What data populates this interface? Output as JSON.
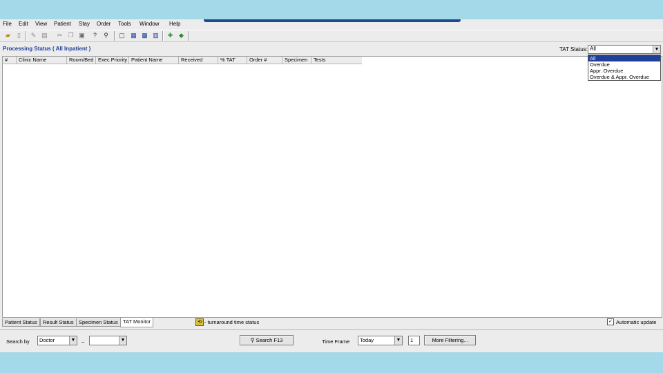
{
  "menu": [
    "File",
    "Edit",
    "View",
    "Patient",
    "Stay",
    "Order",
    "Tools",
    "Window",
    "Help"
  ],
  "toolbar_icons": [
    "folder-open",
    "document",
    "edit",
    "print",
    "cut",
    "copy",
    "paste",
    "help",
    "find",
    "doc-new",
    "window",
    "grid",
    "chart",
    "lab",
    "pill"
  ],
  "header": {
    "title": "Processing Status ( All Inpatient )",
    "tat_status_label": "TAT Status:",
    "tat_status_value": "All",
    "tat_options": [
      "All",
      "Overdue",
      "Appr. Overdue",
      "Overdue & Appr. Overdue"
    ]
  },
  "columns": [
    "#",
    "Clinic Name",
    "Room/Bed",
    "Exec.Priority",
    "Patient Name",
    "Received",
    "% TAT",
    "Order #",
    "Specimen",
    "Tests"
  ],
  "tabs": [
    "Patient Status",
    "Result Status",
    "Specimen Status",
    "TAT Monitor"
  ],
  "turnaround_label": "- turnaround time status",
  "auto_update": {
    "label": "Automatic update",
    "checked": true
  },
  "search": {
    "search_by_label": "Search by",
    "search_by_value": "Doctor",
    "dash": "–",
    "second_value": "",
    "search_button": "Search F13",
    "time_frame_label": "Time Frame",
    "time_frame_value": "Today",
    "count_value": "1",
    "more_filtering": "More Filtering..."
  }
}
